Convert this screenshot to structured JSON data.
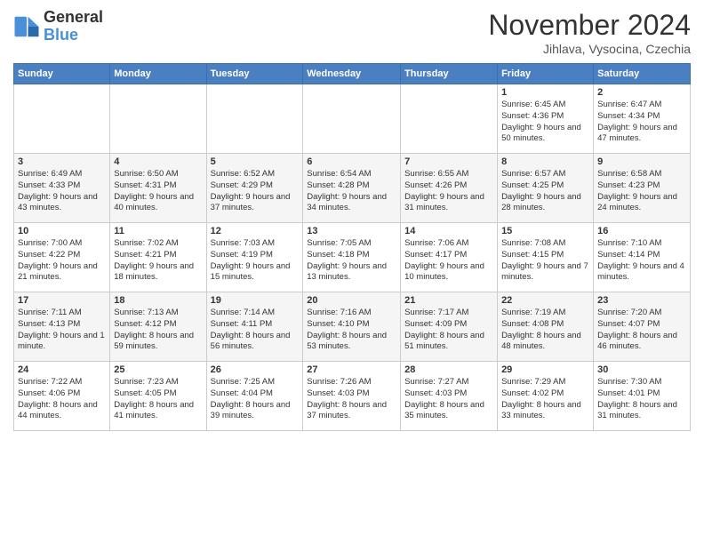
{
  "header": {
    "logo_line1": "General",
    "logo_line2": "Blue",
    "month": "November 2024",
    "location": "Jihlava, Vysocina, Czechia"
  },
  "days_of_week": [
    "Sunday",
    "Monday",
    "Tuesday",
    "Wednesday",
    "Thursday",
    "Friday",
    "Saturday"
  ],
  "weeks": [
    [
      {
        "day": "",
        "info": ""
      },
      {
        "day": "",
        "info": ""
      },
      {
        "day": "",
        "info": ""
      },
      {
        "day": "",
        "info": ""
      },
      {
        "day": "",
        "info": ""
      },
      {
        "day": "1",
        "info": "Sunrise: 6:45 AM\nSunset: 4:36 PM\nDaylight: 9 hours and 50 minutes."
      },
      {
        "day": "2",
        "info": "Sunrise: 6:47 AM\nSunset: 4:34 PM\nDaylight: 9 hours and 47 minutes."
      }
    ],
    [
      {
        "day": "3",
        "info": "Sunrise: 6:49 AM\nSunset: 4:33 PM\nDaylight: 9 hours and 43 minutes."
      },
      {
        "day": "4",
        "info": "Sunrise: 6:50 AM\nSunset: 4:31 PM\nDaylight: 9 hours and 40 minutes."
      },
      {
        "day": "5",
        "info": "Sunrise: 6:52 AM\nSunset: 4:29 PM\nDaylight: 9 hours and 37 minutes."
      },
      {
        "day": "6",
        "info": "Sunrise: 6:54 AM\nSunset: 4:28 PM\nDaylight: 9 hours and 34 minutes."
      },
      {
        "day": "7",
        "info": "Sunrise: 6:55 AM\nSunset: 4:26 PM\nDaylight: 9 hours and 31 minutes."
      },
      {
        "day": "8",
        "info": "Sunrise: 6:57 AM\nSunset: 4:25 PM\nDaylight: 9 hours and 28 minutes."
      },
      {
        "day": "9",
        "info": "Sunrise: 6:58 AM\nSunset: 4:23 PM\nDaylight: 9 hours and 24 minutes."
      }
    ],
    [
      {
        "day": "10",
        "info": "Sunrise: 7:00 AM\nSunset: 4:22 PM\nDaylight: 9 hours and 21 minutes."
      },
      {
        "day": "11",
        "info": "Sunrise: 7:02 AM\nSunset: 4:21 PM\nDaylight: 9 hours and 18 minutes."
      },
      {
        "day": "12",
        "info": "Sunrise: 7:03 AM\nSunset: 4:19 PM\nDaylight: 9 hours and 15 minutes."
      },
      {
        "day": "13",
        "info": "Sunrise: 7:05 AM\nSunset: 4:18 PM\nDaylight: 9 hours and 13 minutes."
      },
      {
        "day": "14",
        "info": "Sunrise: 7:06 AM\nSunset: 4:17 PM\nDaylight: 9 hours and 10 minutes."
      },
      {
        "day": "15",
        "info": "Sunrise: 7:08 AM\nSunset: 4:15 PM\nDaylight: 9 hours and 7 minutes."
      },
      {
        "day": "16",
        "info": "Sunrise: 7:10 AM\nSunset: 4:14 PM\nDaylight: 9 hours and 4 minutes."
      }
    ],
    [
      {
        "day": "17",
        "info": "Sunrise: 7:11 AM\nSunset: 4:13 PM\nDaylight: 9 hours and 1 minute."
      },
      {
        "day": "18",
        "info": "Sunrise: 7:13 AM\nSunset: 4:12 PM\nDaylight: 8 hours and 59 minutes."
      },
      {
        "day": "19",
        "info": "Sunrise: 7:14 AM\nSunset: 4:11 PM\nDaylight: 8 hours and 56 minutes."
      },
      {
        "day": "20",
        "info": "Sunrise: 7:16 AM\nSunset: 4:10 PM\nDaylight: 8 hours and 53 minutes."
      },
      {
        "day": "21",
        "info": "Sunrise: 7:17 AM\nSunset: 4:09 PM\nDaylight: 8 hours and 51 minutes."
      },
      {
        "day": "22",
        "info": "Sunrise: 7:19 AM\nSunset: 4:08 PM\nDaylight: 8 hours and 48 minutes."
      },
      {
        "day": "23",
        "info": "Sunrise: 7:20 AM\nSunset: 4:07 PM\nDaylight: 8 hours and 46 minutes."
      }
    ],
    [
      {
        "day": "24",
        "info": "Sunrise: 7:22 AM\nSunset: 4:06 PM\nDaylight: 8 hours and 44 minutes."
      },
      {
        "day": "25",
        "info": "Sunrise: 7:23 AM\nSunset: 4:05 PM\nDaylight: 8 hours and 41 minutes."
      },
      {
        "day": "26",
        "info": "Sunrise: 7:25 AM\nSunset: 4:04 PM\nDaylight: 8 hours and 39 minutes."
      },
      {
        "day": "27",
        "info": "Sunrise: 7:26 AM\nSunset: 4:03 PM\nDaylight: 8 hours and 37 minutes."
      },
      {
        "day": "28",
        "info": "Sunrise: 7:27 AM\nSunset: 4:03 PM\nDaylight: 8 hours and 35 minutes."
      },
      {
        "day": "29",
        "info": "Sunrise: 7:29 AM\nSunset: 4:02 PM\nDaylight: 8 hours and 33 minutes."
      },
      {
        "day": "30",
        "info": "Sunrise: 7:30 AM\nSunset: 4:01 PM\nDaylight: 8 hours and 31 minutes."
      }
    ]
  ]
}
